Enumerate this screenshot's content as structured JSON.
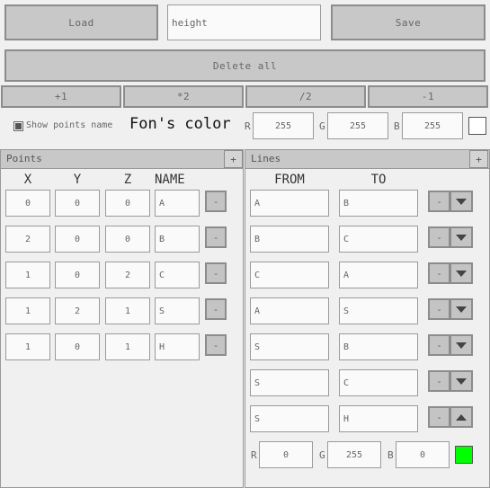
{
  "toolbar": {
    "load": "Load",
    "name_value": "height",
    "save": "Save",
    "delete_all": "Delete all"
  },
  "ops": [
    "+1",
    "*2",
    "/2",
    "-1"
  ],
  "options": {
    "show_points_label": "Show points name",
    "show_points_checked": true,
    "font_color_label": "Fon's color",
    "rgb_labels": [
      "R",
      "G",
      "B"
    ],
    "font_rgb": [
      "255",
      "255",
      "255"
    ],
    "font_swatch": "#ffffff"
  },
  "points": {
    "title": "Points",
    "add": "+",
    "headers": [
      "X",
      "Y",
      "Z",
      "NAME"
    ],
    "remove": "-",
    "rows": [
      [
        "0",
        "0",
        "0",
        "A"
      ],
      [
        "2",
        "0",
        "0",
        "B"
      ],
      [
        "1",
        "0",
        "2",
        "C"
      ],
      [
        "1",
        "2",
        "1",
        "S"
      ],
      [
        "1",
        "0",
        "1",
        "H"
      ]
    ]
  },
  "lines": {
    "title": "Lines",
    "add": "+",
    "headers": [
      "FROM",
      "TO"
    ],
    "remove": "-",
    "rows": [
      [
        "A",
        "B"
      ],
      [
        "B",
        "C"
      ],
      [
        "C",
        "A"
      ],
      [
        "A",
        "S"
      ],
      [
        "S",
        "B"
      ],
      [
        "S",
        "C"
      ],
      [
        "S",
        "H"
      ]
    ],
    "expanded_row": 6,
    "rgb_labels": [
      "R",
      "G",
      "B"
    ],
    "rgb": [
      "0",
      "255",
      "0"
    ],
    "swatch": "#00ff00"
  }
}
